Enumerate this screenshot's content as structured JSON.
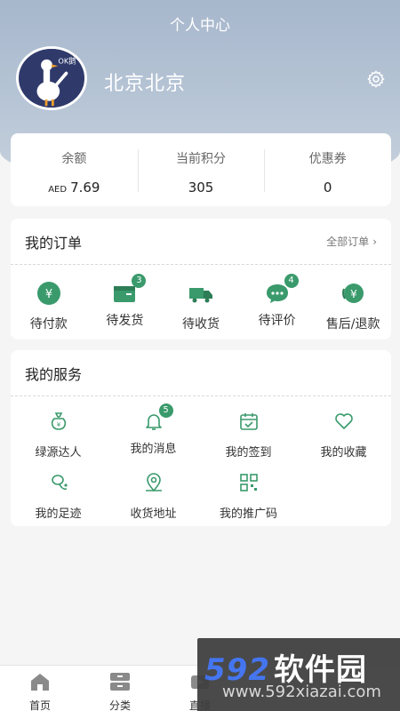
{
  "header": {
    "title": "个人中心",
    "user_name": "北京北京",
    "avatar_text": "OK鹅"
  },
  "stats": [
    {
      "label": "余额",
      "currency": "AED",
      "value": "7.69"
    },
    {
      "label": "当前积分",
      "value": "305"
    },
    {
      "label": "优惠券",
      "value": "0"
    }
  ],
  "orders": {
    "title": "我的订单",
    "all_link": "全部订单",
    "items": [
      {
        "label": "待付款",
        "icon": "yen-coin-icon"
      },
      {
        "label": "待发货",
        "icon": "package-icon",
        "badge": "3"
      },
      {
        "label": "待收货",
        "icon": "truck-icon"
      },
      {
        "label": "待评价",
        "icon": "comment-icon",
        "badge": "4"
      },
      {
        "label": "售后/退款",
        "icon": "refund-icon"
      }
    ]
  },
  "services": {
    "title": "我的服务",
    "items": [
      {
        "label": "绿源达人",
        "icon": "money-bag-icon"
      },
      {
        "label": "我的消息",
        "icon": "bell-icon",
        "badge": "5"
      },
      {
        "label": "我的签到",
        "icon": "calendar-check-icon"
      },
      {
        "label": "我的收藏",
        "icon": "heart-icon"
      },
      {
        "label": "我的足迹",
        "icon": "footprint-icon"
      },
      {
        "label": "收货地址",
        "icon": "location-icon"
      },
      {
        "label": "我的推广码",
        "icon": "qrcode-icon"
      }
    ]
  },
  "tabbar": [
    {
      "label": "首页",
      "icon": "home-icon"
    },
    {
      "label": "分类",
      "icon": "category-icon"
    },
    {
      "label": "直播",
      "icon": "live-icon"
    }
  ],
  "watermark": {
    "brand_num": "592",
    "brand_cn": "软件园",
    "url": "www.592xiazai.com"
  },
  "colors": {
    "accent": "#3a9a6c",
    "header": "#a7b7cc"
  }
}
